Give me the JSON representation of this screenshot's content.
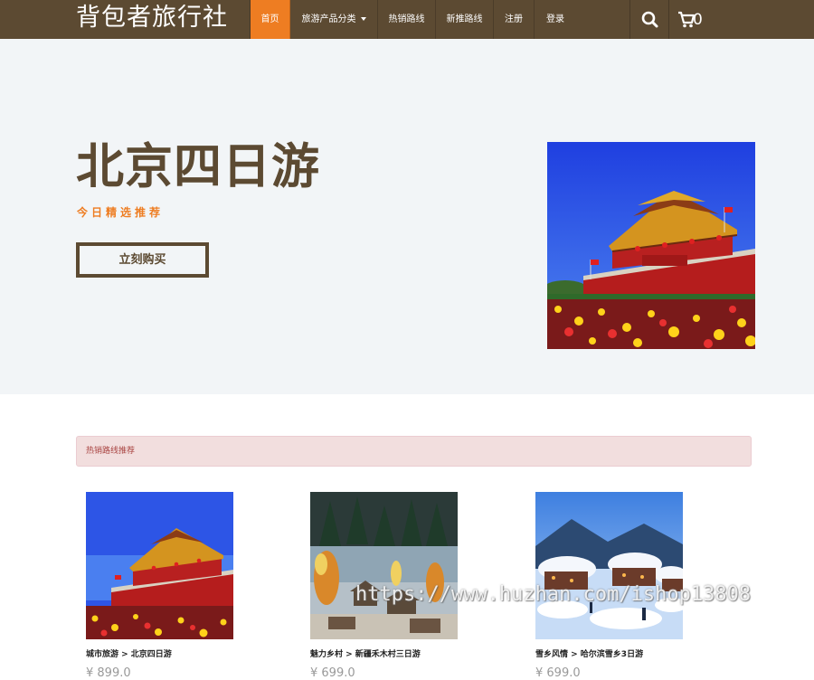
{
  "header": {
    "brand": "背包者旅行社",
    "nav": [
      {
        "label": "首页",
        "active": true
      },
      {
        "label": "旅游产品分类",
        "dropdown": true
      },
      {
        "label": "热销路线"
      },
      {
        "label": "新推路线"
      },
      {
        "label": "注册"
      },
      {
        "label": "登录"
      }
    ],
    "search_icon": "search-icon",
    "cart_icon": "shopping-cart-icon",
    "cart_count": "0"
  },
  "hero": {
    "title": "北京四日游",
    "subtitle": "今日精选推荐",
    "button_label": "立刻购买",
    "image": "tiananmen-photo"
  },
  "section": {
    "alert_text": "热销路线推荐",
    "products": [
      {
        "title": "城市旅游 > 北京四日游",
        "price": "¥ 899.0",
        "image": "tiananmen-photo"
      },
      {
        "title": "魅力乡村 > 新疆禾木村三日游",
        "price": "¥ 699.0",
        "image": "hemu-village-photo"
      },
      {
        "title": "雪乡风情 > 哈尔滨雪乡3日游",
        "price": "¥ 699.0",
        "image": "snow-village-photo"
      }
    ]
  },
  "watermark": "https://www.huzhan.com/ishop13808",
  "colors": {
    "nav_bg": "#5c4a32",
    "accent": "#ee7d22",
    "hero_bg": "#f2f5f7",
    "alert_bg": "#f2dede",
    "alert_text": "#a94442"
  }
}
